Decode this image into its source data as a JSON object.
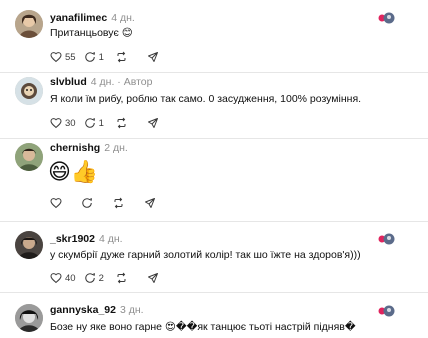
{
  "comments": [
    {
      "username": "yanafilimec",
      "time": "4 дн.",
      "author_label": "",
      "text": "Пританцьовує 😊",
      "likes": "55",
      "replies": "1",
      "reposts": "",
      "show_top_icon": true
    },
    {
      "username": "slvblud",
      "time": "4 дн.",
      "author_label": "Автор",
      "text": "Я коли їм рибу, роблю так само. 0 засудження, 100% розуміння.",
      "likes": "30",
      "replies": "1",
      "reposts": "",
      "show_top_icon": false
    },
    {
      "username": "chernishg",
      "time": "2 дн.",
      "author_label": "",
      "text": "😄👍",
      "likes": "",
      "replies": "",
      "reposts": "",
      "show_top_icon": false
    },
    {
      "username": "_skr1902",
      "time": "4 дн.",
      "author_label": "",
      "text": "у скумбрії дуже гарний золотий колір! так шо їжте на здоров'я)))",
      "likes": "40",
      "replies": "2",
      "reposts": "",
      "show_top_icon": true
    },
    {
      "username": "gannyska_92",
      "time": "3 дн.",
      "author_label": "",
      "text": "Бозе ну яке воно гарне 😍��як танцює тьоті настрій підняв�",
      "likes": "",
      "replies": "",
      "reposts": "",
      "show_top_icon": true
    }
  ],
  "colors": {
    "accent_red": "#e0245e",
    "icon_gray": "#3a3a3a",
    "muted": "#8f8f8f",
    "divider": "#e6e6e6"
  },
  "icons": {
    "like": "heart-icon",
    "reply": "comment-icon",
    "repost": "repost-icon",
    "share": "share-icon",
    "top": "profile-badge-icon"
  }
}
